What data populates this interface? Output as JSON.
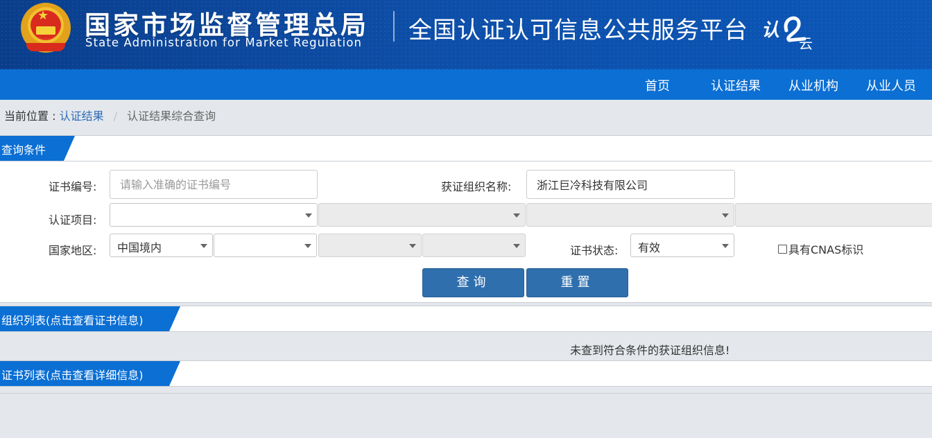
{
  "header": {
    "org_name_cn": "国家市场监督管理总局",
    "org_name_en": "State Administration  for  Market Regulation",
    "platform_title": "全国认证认可信息公共服务平台",
    "logo_text_a": "认",
    "logo_text_b": "云",
    "colors": {
      "header_bg": "#0d4ea8",
      "nav_bg": "#0b6fd4",
      "emblem_red": "#d92b1d",
      "emblem_gold": "#f2c230"
    }
  },
  "nav": {
    "items": [
      {
        "label": "首页"
      },
      {
        "label": "认证结果"
      },
      {
        "label": "从业机构"
      },
      {
        "label": "从业人员"
      }
    ]
  },
  "breadcrumb": {
    "prefix": "当前位置 :",
    "link": "认证结果",
    "separator": "/",
    "current": "认证结果综合查询"
  },
  "query_section": {
    "title": "查询条件",
    "cert_no_label": "证书编号:",
    "cert_no_placeholder": "请输入准确的证书编号",
    "cert_no_value": "",
    "org_name_label": "获证组织名称:",
    "org_name_value": "浙江巨冷科技有限公司",
    "project_label": "认证项目:",
    "project_selects": [
      "",
      "",
      "",
      ""
    ],
    "region_label": "国家地区:",
    "region_selects": [
      "中国境内",
      "",
      "",
      ""
    ],
    "status_label": "证书状态:",
    "status_value": "有效",
    "cnas_label": "具有CNAS标识",
    "cnas_checked": false,
    "search_button": "查询",
    "reset_button": "重置",
    "button_color": "#2f6fae"
  },
  "org_list": {
    "title": "组织列表(点击查看证书信息)",
    "empty_message": "未查到符合条件的获证组织信息!"
  },
  "cert_list": {
    "title": "证书列表(点击查看详细信息)"
  }
}
